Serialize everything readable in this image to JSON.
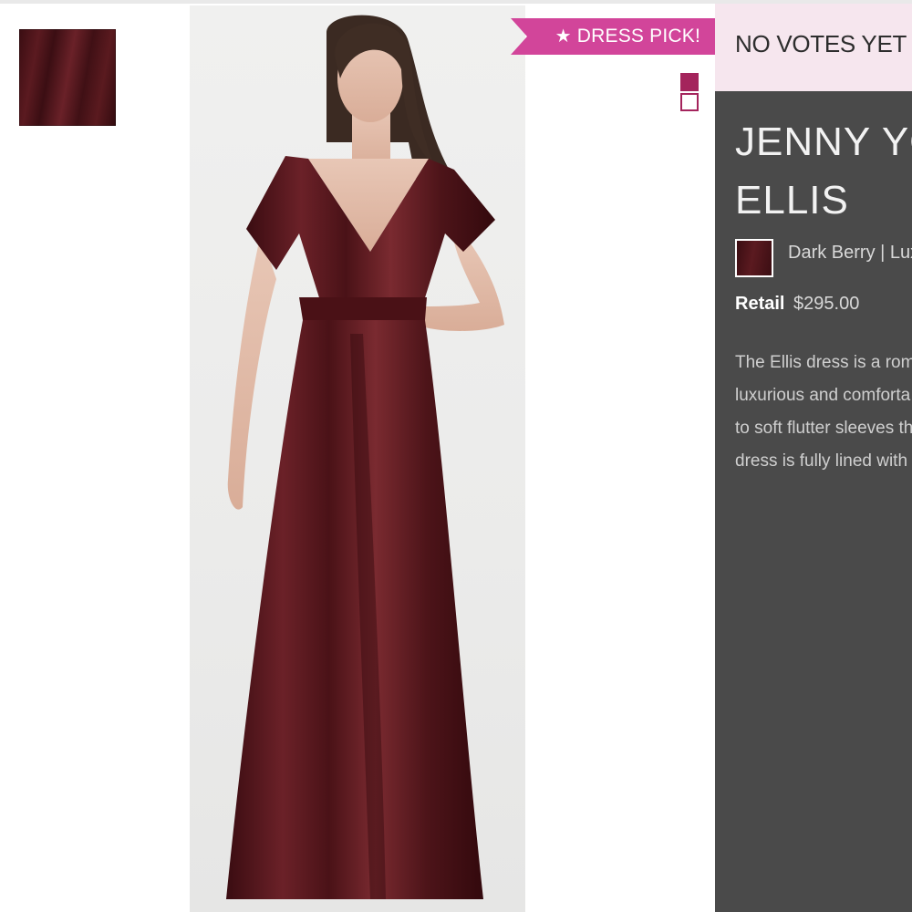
{
  "badge": {
    "icon": "star-icon",
    "label": "DRESS PICK!"
  },
  "votes": {
    "label": "NO VOTES YET"
  },
  "product": {
    "designer": "JENNY YO",
    "style": "ELLIS",
    "color": "Dark Berry | Lux",
    "retail_label": "Retail",
    "price": "$295.00",
    "description_lines": [
      "The Ellis dress is a roma",
      "luxurious and comforta",
      "to soft flutter sleeves the",
      "dress is fully lined with a"
    ]
  },
  "swatches": [
    {
      "name": "swatch-filled",
      "color": "#a4245c"
    },
    {
      "name": "swatch-outline",
      "color": "#a4245c"
    }
  ],
  "colors": {
    "badge": "#d2459a",
    "votes_bg": "#f6e6ee",
    "panel_bg": "#4a4a4a",
    "dress": "#5b1a20"
  }
}
